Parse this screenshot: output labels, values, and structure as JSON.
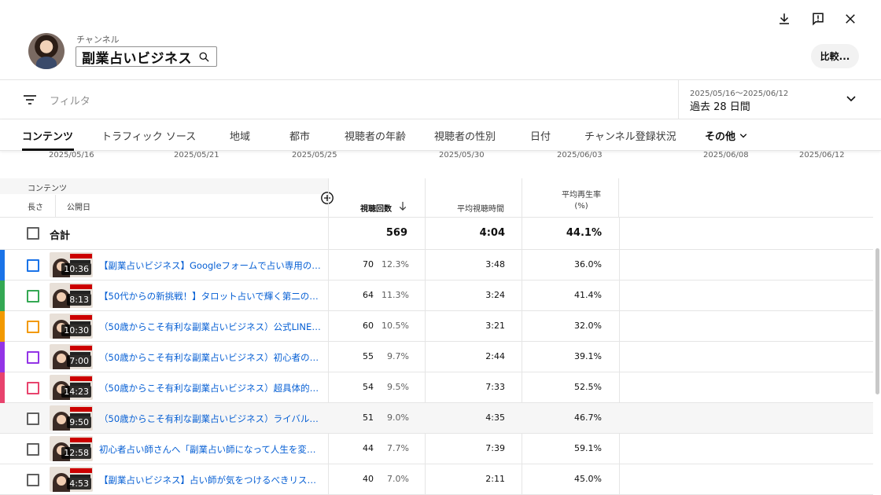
{
  "channel": {
    "label": "チャンネル",
    "name": "副業占いビジネス"
  },
  "header": {
    "compare_label": "比較..."
  },
  "filter": {
    "placeholder": "フィルタ"
  },
  "date": {
    "range": "2025/05/16〜2025/06/12",
    "label": "過去 28 日間"
  },
  "tabs": [
    {
      "label": "コンテンツ",
      "active": true
    },
    {
      "label": "トラフィック ソース"
    },
    {
      "label": "地域"
    },
    {
      "label": "都市"
    },
    {
      "label": "視聴者の年齢"
    },
    {
      "label": "視聴者の性別"
    },
    {
      "label": "日付"
    },
    {
      "label": "チャンネル登録状況"
    },
    {
      "label": "その他"
    }
  ],
  "axis_ticks": [
    "2025/05/16",
    "2025/05/21",
    "2025/05/25",
    "2025/05/30",
    "2025/06/03",
    "2025/06/08",
    "2025/06/12"
  ],
  "table": {
    "group_header": "コンテンツ",
    "col_length": "長さ",
    "col_published": "公開日",
    "col_views": "視聴回数",
    "col_avg_duration": "平均視聴時間",
    "col_avg_rate": "平均再生率\n(%)",
    "total": {
      "label": "合計",
      "views": "569",
      "avg_duration": "4:04",
      "avg_rate": "44.1%"
    },
    "rows": [
      {
        "color": "#1a73e8",
        "duration": "10:36",
        "title": "【副業占いビジネス】Googleフォームで占い専用の項...",
        "views": "70",
        "pct": "12.3%",
        "avg_duration": "3:48",
        "avg_rate": "36.0%"
      },
      {
        "color": "#34a853",
        "duration": "8:13",
        "title": "【50代からの新挑戦！】タロット占いで輝く第二の人...",
        "views": "64",
        "pct": "11.3%",
        "avg_duration": "3:24",
        "avg_rate": "41.4%"
      },
      {
        "color": "#f29900",
        "duration": "10:30",
        "title": "（50歳からこそ有利な副業占いビジネス）公式LINEで...",
        "views": "60",
        "pct": "10.5%",
        "avg_duration": "3:21",
        "avg_rate": "32.0%"
      },
      {
        "color": "#9334e6",
        "duration": "7:00",
        "title": "（50歳からこそ有利な副業占いビジネス）初心者の占...",
        "views": "55",
        "pct": "9.7%",
        "avg_duration": "2:44",
        "avg_rate": "39.1%"
      },
      {
        "color": "#e8436d",
        "duration": "14:23",
        "title": "（50歳からこそ有利な副業占いビジネス）超具体的に...",
        "views": "54",
        "pct": "9.5%",
        "avg_duration": "7:33",
        "avg_rate": "52.5%"
      },
      {
        "color": "",
        "duration": "9:50",
        "title": "（50歳からこそ有利な副業占いビジネス）ライバルを...",
        "views": "51",
        "pct": "9.0%",
        "avg_duration": "4:35",
        "avg_rate": "46.7%"
      },
      {
        "color": "",
        "duration": "12:58",
        "title": "初心者占い師さんへ「副業占い師になって人生を変え...",
        "views": "44",
        "pct": "7.7%",
        "avg_duration": "7:39",
        "avg_rate": "59.1%"
      },
      {
        "color": "",
        "duration": "4:53",
        "title": "【副業占いビジネス】占い師が気をつけるべきリスク...",
        "views": "40",
        "pct": "7.0%",
        "avg_duration": "2:11",
        "avg_rate": "45.0%"
      }
    ]
  }
}
